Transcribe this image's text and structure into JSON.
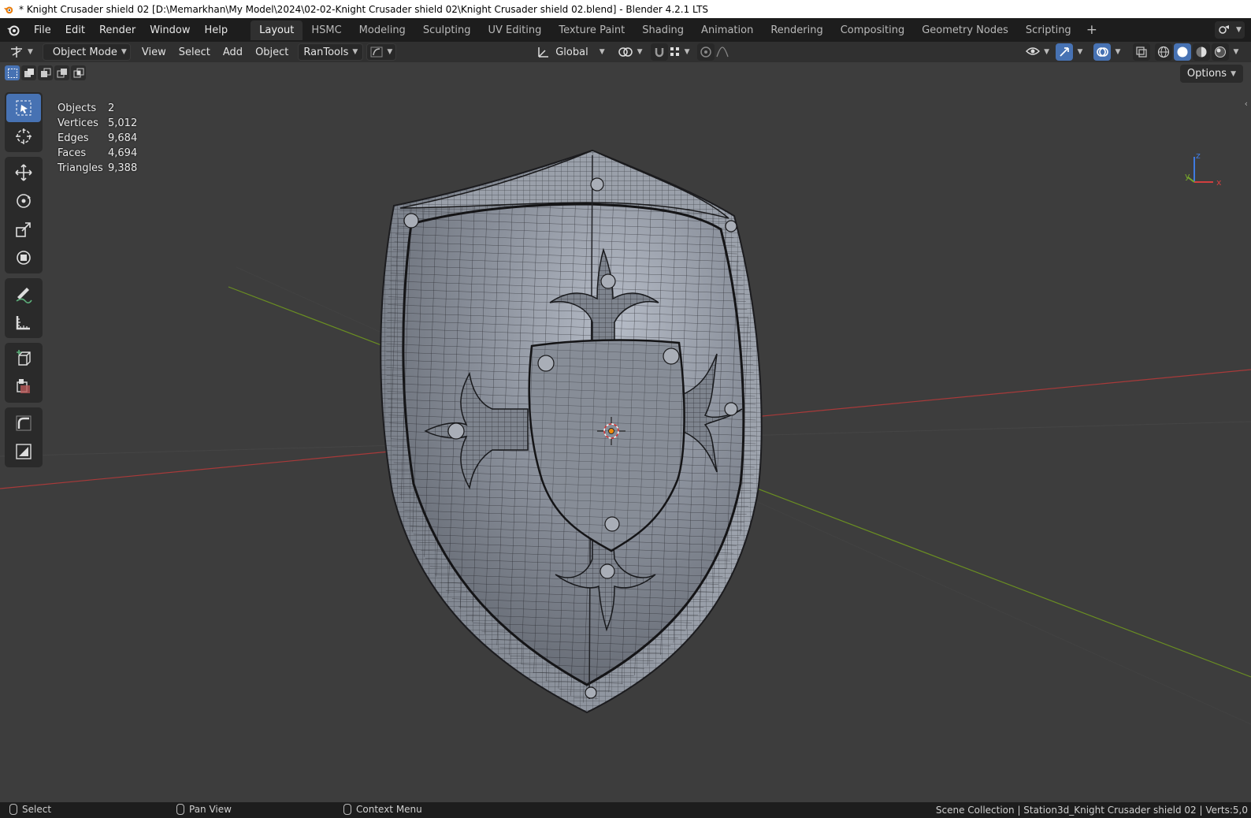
{
  "window": {
    "title": "* Knight Crusader shield 02 [D:\\Memarkhan\\My Model\\2024\\02-02-Knight Crusader shield 02\\Knight Crusader shield 02.blend] - Blender 4.2.1 LTS"
  },
  "menu": [
    "File",
    "Edit",
    "Render",
    "Window",
    "Help"
  ],
  "workspaces": {
    "active": "Layout",
    "tabs": [
      "Layout",
      "HSMC",
      "Modeling",
      "Sculpting",
      "UV Editing",
      "Texture Paint",
      "Shading",
      "Animation",
      "Rendering",
      "Compositing",
      "Geometry Nodes",
      "Scripting"
    ]
  },
  "header": {
    "mode": "Object Mode",
    "view": "View",
    "select": "Select",
    "add": "Add",
    "object": "Object",
    "addon": "RanTools",
    "orientation": "Global",
    "options": "Options"
  },
  "stats": {
    "objects_label": "Objects",
    "objects": "2",
    "vertices_label": "Vertices",
    "vertices": "5,012",
    "edges_label": "Edges",
    "edges": "9,684",
    "faces_label": "Faces",
    "faces": "4,694",
    "triangles_label": "Triangles",
    "triangles": "9,388"
  },
  "gizmo": {
    "x": "x",
    "y": "y",
    "z": "z"
  },
  "statusbar": {
    "left_click": "Select",
    "middle_click": "Pan View",
    "right_click": "Context Menu",
    "right_text": "Scene Collection | Station3d_Knight Crusader shield 02 | Verts:5,0"
  },
  "colors": {
    "accent": "#4772b3",
    "x_axis": "#a83a3a",
    "y_axis": "#6a8e22",
    "viewport_bg": "#3d3d3d"
  },
  "icons": [
    "blender-logo",
    "editor-type-icon",
    "object-mode-icon",
    "transform-orientation-icon",
    "pivot-icon",
    "snap-icon",
    "proportional-edit-icon",
    "visibility-icon",
    "gizmo-icon",
    "overlay-icon",
    "xray-icon",
    "wireframe-shading-icon",
    "solid-shading-icon",
    "material-shading-icon",
    "rendered-shading-icon",
    "select-box-tool-icon",
    "cursor-tool-icon",
    "move-tool-icon",
    "rotate-tool-icon",
    "scale-tool-icon",
    "transform-tool-icon",
    "annotate-tool-icon",
    "measure-tool-icon",
    "add-cube-tool-icon",
    "extra-tool-icon",
    "bend-tool-icon",
    "cage-tool-icon"
  ]
}
